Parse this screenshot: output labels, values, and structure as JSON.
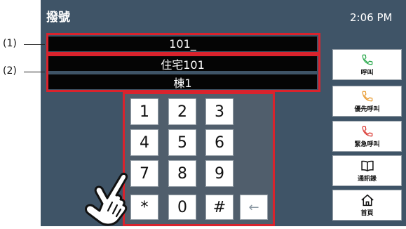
{
  "header": {
    "title": "撥號",
    "time": "2:06 PM"
  },
  "fields": {
    "number": "101_",
    "residence": "住宅101",
    "building": "棟1"
  },
  "callouts": [
    "(1)",
    "(2)"
  ],
  "keypad": {
    "keys": [
      "1",
      "2",
      "3",
      "4",
      "5",
      "6",
      "7",
      "8",
      "9",
      "*",
      "0",
      "#"
    ],
    "back": "←"
  },
  "side_buttons": [
    {
      "label": "呼叫",
      "icon": "phone-icon",
      "color": "#27a84a"
    },
    {
      "label": "優先呼叫",
      "icon": "phone-icon",
      "color": "#e8982a"
    },
    {
      "label": "緊急呼叫",
      "icon": "phone-icon",
      "color": "#d9322c"
    },
    {
      "label": "通訊錄",
      "icon": "book-icon",
      "color": "#111111"
    },
    {
      "label": "首頁",
      "icon": "home-icon",
      "color": "#111111"
    }
  ],
  "colors": {
    "background": "#3f5467",
    "highlight": "#d9232d"
  }
}
